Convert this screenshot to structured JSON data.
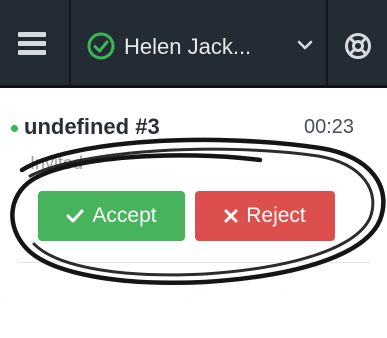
{
  "header": {
    "agent_name": "Helen Jack...",
    "status": "available",
    "menu_icon": "hamburger-menu-icon",
    "status_icon": "check-circle-icon",
    "dropdown_icon": "chevron-down-icon",
    "settings_icon": "lifebuoy-icon"
  },
  "call": {
    "caller": "undefined #3",
    "timer": "00:23",
    "state": "Invited",
    "accept_label": "Accept",
    "reject_label": "Reject"
  },
  "colors": {
    "header_bg": "#232b35",
    "accept": "#47b35c",
    "reject": "#dc4f4c",
    "status_green": "#3cb554"
  }
}
